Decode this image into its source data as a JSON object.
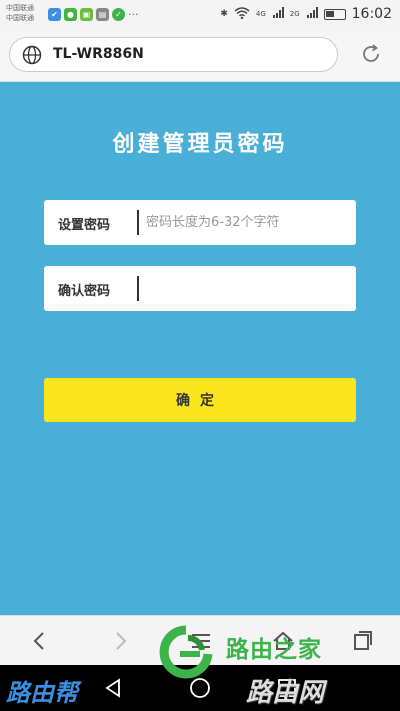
{
  "status_bar": {
    "carrier1": "中国联通",
    "carrier2": "中国联通",
    "net1": "4G",
    "net2": "2G",
    "time": "16:02"
  },
  "browser": {
    "url": "TL-WR886N"
  },
  "page": {
    "title": "创建管理员密码",
    "set_password_label": "设置密码",
    "set_password_placeholder": "密码长度为6-32个字符",
    "confirm_password_label": "确认密码",
    "confirm_password_placeholder": "",
    "confirm_button": "确定"
  },
  "watermark": {
    "left_text": "路由帮",
    "right_top": "路由之家",
    "right_bottom": "路由网"
  },
  "colors": {
    "background": "#4aafd6",
    "button": "#fbe51c"
  }
}
